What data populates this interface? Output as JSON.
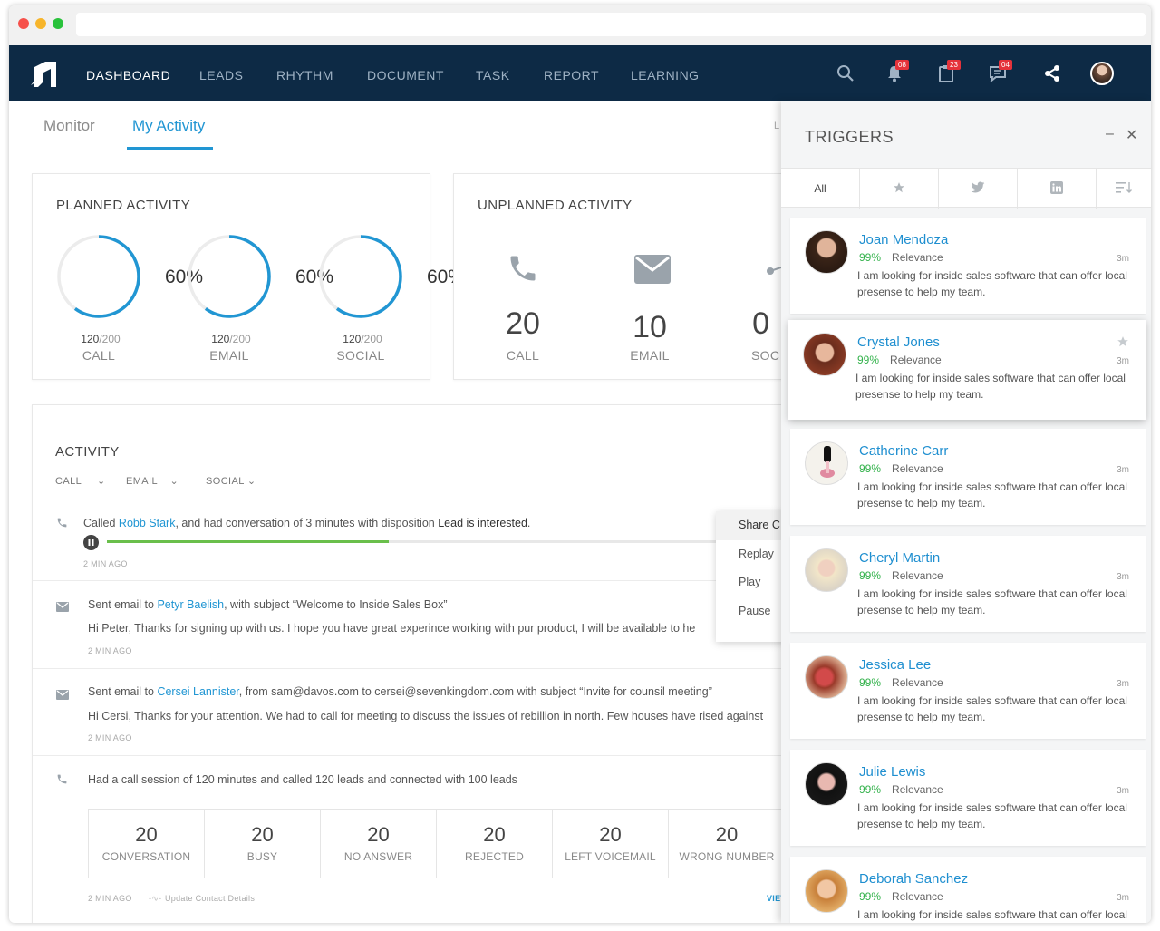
{
  "nav": {
    "items": [
      "DASHBOARD",
      "LEADS",
      "RHYTHM",
      "DOCUMENT",
      "TASK",
      "REPORT",
      "LEARNING"
    ],
    "badges": {
      "notifications": "08",
      "tasks": "23",
      "messages": "04"
    }
  },
  "tabs": {
    "monitor": "Monitor",
    "activity": "My Activity",
    "partial": "L"
  },
  "planned": {
    "title": "PLANNED ACTIVITY",
    "items": [
      {
        "pct": "60%",
        "done": "120",
        "total": "/200",
        "label": "CALL",
        "progress": 0.6
      },
      {
        "pct": "60%",
        "done": "120",
        "total": "/200",
        "label": "EMAIL",
        "progress": 0.6
      },
      {
        "pct": "60%",
        "done": "120",
        "total": "/200",
        "label": "SOCIAL",
        "progress": 0.6
      }
    ]
  },
  "unplanned": {
    "title": "UNPLANNED ACTIVITY",
    "items": [
      {
        "value": "20",
        "label": "CALL"
      },
      {
        "value": "10",
        "label": "EMAIL"
      },
      {
        "value": "0",
        "label": "SOC"
      }
    ]
  },
  "activity": {
    "title": "ACTIVITY",
    "filters": [
      "CALL",
      "EMAIL",
      "SOCIAL"
    ],
    "row1": {
      "pre": "Called ",
      "name": "Robb Stark",
      "mid": ", and had conversation of 3 minutes with disposition ",
      "bold": "Lead is interested",
      "post": ".",
      "ago": "2 MIN AGO",
      "playback_progress": 0.42
    },
    "row2": {
      "pre": "Sent email to ",
      "name": "Petyr Baelish",
      "post": ", with subject “Welcome to Inside Sales Box”",
      "body": "Hi Peter, Thanks for signing up with us. I hope you have great experince working with pur product, I will be available to he",
      "ago": "2 MIN AGO"
    },
    "row3": {
      "pre": "Sent email to ",
      "name": "Cersei Lannister",
      "post": ", from sam@davos.com to cersei@sevenkingdom.com with subject “Invite for counsil meeting”",
      "body": "Hi Cersi, Thanks for your attention. We had to call for meeting to discuss the issues of rebillion in north. Few houses have rised against",
      "ago": "2 MIN AGO"
    },
    "row4": {
      "text": "Had a call session of 120 minutes and called 120 leads and connected with 100 leads",
      "ago": "2 MIN AGO",
      "update": "Update Contact Details",
      "view": "VIEW"
    },
    "stats": [
      {
        "n": "20",
        "l": "CONVERSATION"
      },
      {
        "n": "20",
        "l": "BUSY"
      },
      {
        "n": "20",
        "l": "NO ANSWER"
      },
      {
        "n": "20",
        "l": "REJECTED"
      },
      {
        "n": "20",
        "l": "LEFT VOICEMAIL"
      },
      {
        "n": "20",
        "l": "WRONG NUMBER"
      }
    ]
  },
  "context_menu": [
    "Share C",
    "Replay",
    "Play",
    "Pause"
  ],
  "triggers": {
    "title": "TRIGGERS",
    "all_tab": "All",
    "relevance_label": "Relevance",
    "people": [
      {
        "name": "Joan Mendoza",
        "pct": "99%",
        "time": "3m",
        "msg": "I am looking for inside sales software that can offer local presense to help my team."
      },
      {
        "name": "Crystal Jones",
        "pct": "99%",
        "time": "3m",
        "msg": "I am looking for inside sales software that can offer local presense to help my team."
      },
      {
        "name": "Catherine Carr",
        "pct": "99%",
        "time": "3m",
        "msg": "I am looking for inside sales software that can offer local presense to help my team."
      },
      {
        "name": "Cheryl Martin",
        "pct": "99%",
        "time": "3m",
        "msg": "I am looking for inside sales software that can offer local presense to help my team."
      },
      {
        "name": "Jessica Lee",
        "pct": "99%",
        "time": "3m",
        "msg": "I am looking for inside sales software that can offer local presense to help my team."
      },
      {
        "name": "Julie Lewis",
        "pct": "99%",
        "time": "3m",
        "msg": "I am looking for inside sales software that can offer local presense to help my team."
      },
      {
        "name": "Deborah Sanchez",
        "pct": "99%",
        "time": "3m",
        "msg": "I am looking for inside sales software that can offer local presense to help my team."
      }
    ]
  },
  "colors": {
    "accent": "#2196d3",
    "nav_bg": "#0d2a45",
    "green": "#4caf50",
    "badge": "#e5333b"
  }
}
